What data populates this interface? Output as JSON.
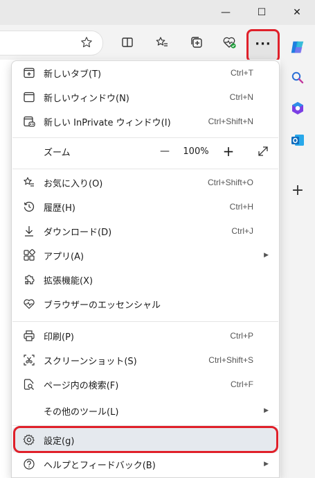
{
  "window": {
    "minimize_glyph": "—",
    "maximize_glyph": "☐",
    "close_glyph": "✕"
  },
  "toolbar": {
    "more_glyph": "···"
  },
  "zoom": {
    "label": "ズーム",
    "minus": "—",
    "value": "100%",
    "plus": "+"
  },
  "menu": {
    "items": [
      {
        "label": "新しいタブ(T)",
        "shortcut": "Ctrl+T"
      },
      {
        "label": "新しいウィンドウ(N)",
        "shortcut": "Ctrl+N"
      },
      {
        "label": "新しい InPrivate ウィンドウ(I)",
        "shortcut": "Ctrl+Shift+N"
      },
      {
        "label": "お気に入り(O)",
        "shortcut": "Ctrl+Shift+O"
      },
      {
        "label": "履歴(H)",
        "shortcut": "Ctrl+H"
      },
      {
        "label": "ダウンロード(D)",
        "shortcut": "Ctrl+J"
      },
      {
        "label": "アプリ(A)",
        "shortcut": ""
      },
      {
        "label": "拡張機能(X)",
        "shortcut": ""
      },
      {
        "label": "ブラウザーのエッセンシャル",
        "shortcut": ""
      },
      {
        "label": "印刷(P)",
        "shortcut": "Ctrl+P"
      },
      {
        "label": "スクリーンショット(S)",
        "shortcut": "Ctrl+Shift+S"
      },
      {
        "label": "ページ内の検索(F)",
        "shortcut": "Ctrl+F"
      },
      {
        "label": "その他のツール(L)",
        "shortcut": ""
      },
      {
        "label": "設定(g)",
        "shortcut": ""
      },
      {
        "label": "ヘルプとフィードバック(B)",
        "shortcut": ""
      }
    ]
  },
  "sidebar": {
    "add_glyph": "+"
  },
  "colors": {
    "highlight": "#e0202a",
    "selected_bg": "#e5e9ee",
    "copilot_blue": "#1f7fe0"
  }
}
